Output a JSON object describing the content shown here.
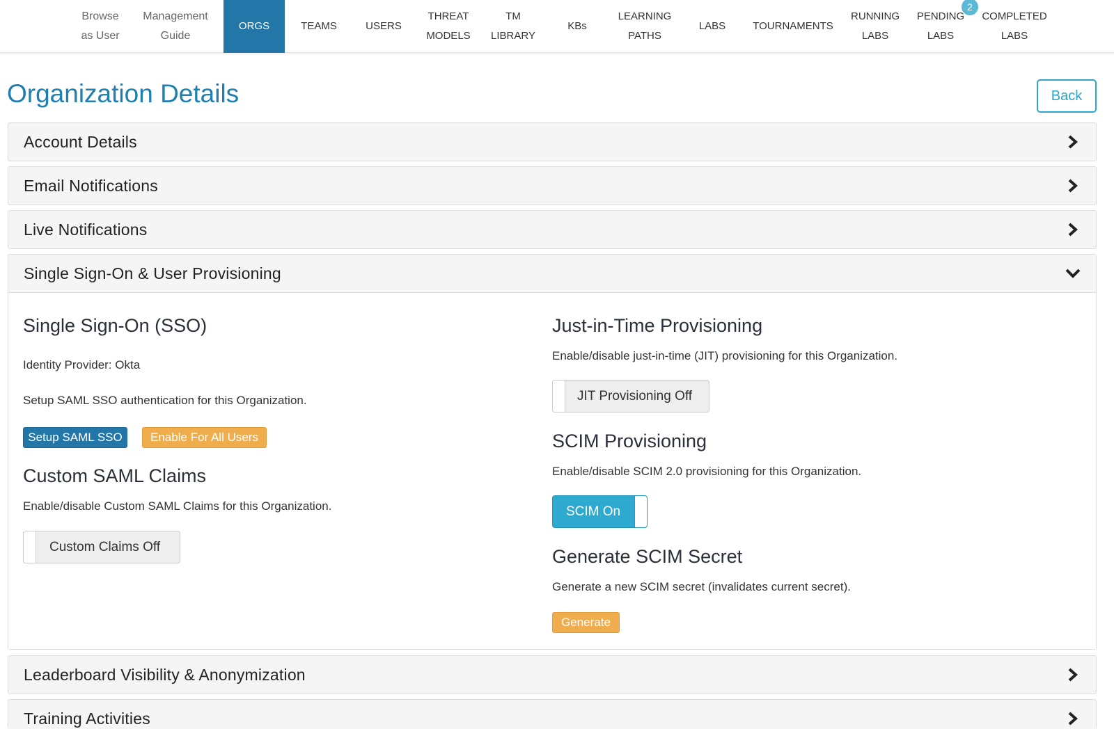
{
  "nav": {
    "items": [
      {
        "label": "Browse\nas User",
        "active": false
      },
      {
        "label": "Management\nGuide",
        "active": false
      },
      {
        "label": "ORGS",
        "active": true
      },
      {
        "label": "TEAMS",
        "active": false
      },
      {
        "label": "USERS",
        "active": false
      },
      {
        "label": "THREAT\nMODELS",
        "active": false
      },
      {
        "label": "TM\nLIBRARY",
        "active": false
      },
      {
        "label": "KBs",
        "active": false
      },
      {
        "label": "LEARNING\nPATHS",
        "active": false
      },
      {
        "label": "LABS",
        "active": false
      },
      {
        "label": "TOURNAMENTS",
        "active": false
      },
      {
        "label": "RUNNING\nLABS",
        "active": false
      },
      {
        "label": "PENDING\nLABS",
        "active": false
      },
      {
        "label": "COMPLETED\nLABS",
        "active": false
      }
    ],
    "pending_badge": "2"
  },
  "page": {
    "title": "Organization Details",
    "back_label": "Back"
  },
  "panels": {
    "account": "Account Details",
    "email": "Email Notifications",
    "live": "Live Notifications",
    "sso": "Single Sign-On & User Provisioning",
    "leaderboard": "Leaderboard Visibility & Anonymization",
    "training": "Training Activities"
  },
  "sso": {
    "heading": "Single Sign-On (SSO)",
    "identity_provider": "Identity Provider: Okta",
    "setup_text": "Setup SAML SSO authentication for this Organization.",
    "setup_button": "Setup SAML SSO",
    "enable_all_button": "Enable For All Users"
  },
  "custom_claims": {
    "heading": "Custom SAML Claims",
    "description": "Enable/disable Custom SAML Claims for this Organization.",
    "toggle_label": "Custom Claims Off",
    "enabled": false
  },
  "jit": {
    "heading": "Just-in-Time Provisioning",
    "description": "Enable/disable just-in-time (JIT) provisioning for this Organization.",
    "toggle_label": "JIT Provisioning Off",
    "enabled": false
  },
  "scim": {
    "heading": "SCIM Provisioning",
    "description": "Enable/disable SCIM 2.0 provisioning for this Organization.",
    "toggle_label": "SCIM On",
    "enabled": true
  },
  "scim_secret": {
    "heading": "Generate SCIM Secret",
    "description": "Generate a new SCIM secret (invalidates current secret).",
    "button": "Generate"
  },
  "colors": {
    "brand": "#2277a8",
    "title": "#1f7fae",
    "accent": "#2eaad1",
    "warning": "#f0ad4e"
  }
}
